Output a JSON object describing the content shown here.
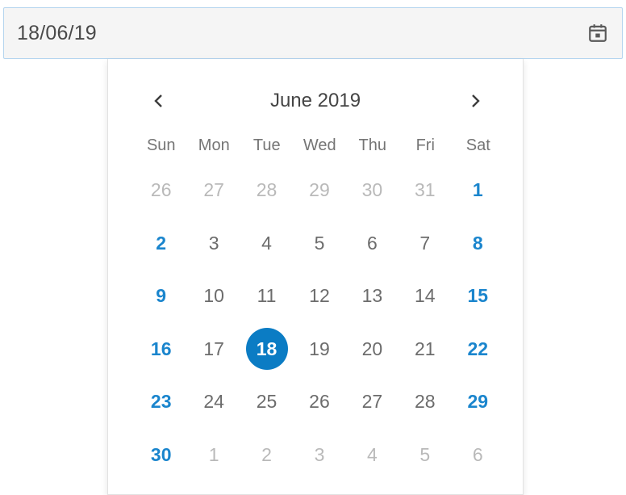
{
  "date_input": {
    "value": "18/06/19",
    "icon": "calendar-icon"
  },
  "calendar": {
    "month_title": "June 2019",
    "prev_icon": "chevron-left-icon",
    "next_icon": "chevron-right-icon",
    "weekdays": [
      "Sun",
      "Mon",
      "Tue",
      "Wed",
      "Thu",
      "Fri",
      "Sat"
    ],
    "weeks": [
      [
        "26",
        "27",
        "28",
        "29",
        "30",
        "31",
        "1"
      ],
      [
        "2",
        "3",
        "4",
        "5",
        "6",
        "7",
        "8"
      ],
      [
        "9",
        "10",
        "11",
        "12",
        "13",
        "14",
        "15"
      ],
      [
        "16",
        "17",
        "18",
        "19",
        "20",
        "21",
        "22"
      ],
      [
        "23",
        "24",
        "25",
        "26",
        "27",
        "28",
        "29"
      ],
      [
        "30",
        "1",
        "2",
        "3",
        "4",
        "5",
        "6"
      ]
    ],
    "selected_day": "18",
    "colors": {
      "accent": "#0b7cc4",
      "weekend": "#1a85cd",
      "other_month": "#b9b9b9",
      "day": "#6c6c6c"
    }
  }
}
